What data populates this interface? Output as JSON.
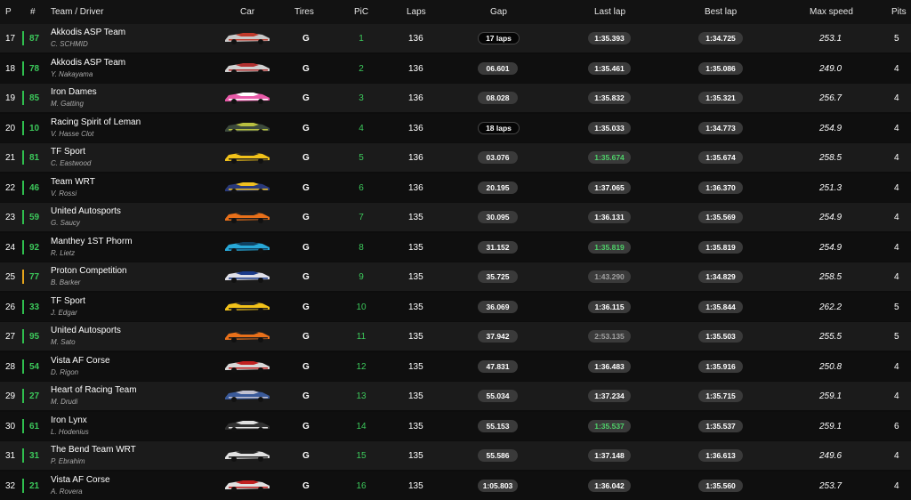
{
  "headers": {
    "p": "P",
    "num": "#",
    "team": "Team / Driver",
    "car": "Car",
    "tires": "Tires",
    "pic": "PiC",
    "laps": "Laps",
    "gap": "Gap",
    "last": "Last lap",
    "best": "Best lap",
    "speed": "Max speed",
    "pits": "Pits"
  },
  "rows": [
    {
      "p": "17",
      "num": "87",
      "team": "Akkodis ASP Team",
      "driver": "C. SCHMID",
      "tire": "G",
      "pic": "1",
      "laps": "136",
      "gap": "17 laps",
      "last": "1:35.393",
      "best": "1:34.725",
      "speed": "253.1",
      "pits": "5",
      "bar": "pro",
      "gap_style": "dark",
      "last_style": "normal",
      "car_colors": [
        "#c8c8c8",
        "#c0392b"
      ]
    },
    {
      "p": "18",
      "num": "78",
      "team": "Akkodis ASP Team",
      "driver": "Y. Nakayama",
      "tire": "G",
      "pic": "2",
      "laps": "136",
      "gap": "06.601",
      "last": "1:35.461",
      "best": "1:35.086",
      "speed": "249.0",
      "pits": "4",
      "bar": "pro",
      "gap_style": "normal",
      "last_style": "normal",
      "car_colors": [
        "#d0d0d0",
        "#b03030"
      ]
    },
    {
      "p": "19",
      "num": "85",
      "team": "Iron Dames",
      "driver": "M. Gatting",
      "tire": "G",
      "pic": "3",
      "laps": "136",
      "gap": "08.028",
      "last": "1:35.832",
      "best": "1:35.321",
      "speed": "256.7",
      "pits": "4",
      "bar": "pro",
      "gap_style": "normal",
      "last_style": "normal",
      "car_colors": [
        "#e85aa8",
        "#ffffff"
      ]
    },
    {
      "p": "20",
      "num": "10",
      "team": "Racing Spirit of Leman",
      "driver": "V. Hasse Clot",
      "tire": "G",
      "pic": "4",
      "laps": "136",
      "gap": "18 laps",
      "last": "1:35.033",
      "best": "1:34.773",
      "speed": "254.9",
      "pits": "4",
      "bar": "pro",
      "gap_style": "dark",
      "last_style": "normal",
      "car_colors": [
        "#3c4a3c",
        "#b8c040"
      ]
    },
    {
      "p": "21",
      "num": "81",
      "team": "TF Sport",
      "driver": "C. Eastwood",
      "tire": "G",
      "pic": "5",
      "laps": "136",
      "gap": "03.076",
      "last": "1:35.674",
      "best": "1:35.674",
      "speed": "258.5",
      "pits": "4",
      "bar": "pro",
      "gap_style": "normal",
      "last_style": "green",
      "car_colors": [
        "#f2c21a",
        "#222222"
      ]
    },
    {
      "p": "22",
      "num": "46",
      "team": "Team WRT",
      "driver": "V. Rossi",
      "tire": "G",
      "pic": "6",
      "laps": "136",
      "gap": "20.195",
      "last": "1:37.065",
      "best": "1:36.370",
      "speed": "251.3",
      "pits": "4",
      "bar": "pro",
      "gap_style": "normal",
      "last_style": "normal",
      "car_colors": [
        "#2a3a7a",
        "#f0c020"
      ]
    },
    {
      "p": "23",
      "num": "59",
      "team": "United Autosports",
      "driver": "G. Saucy",
      "tire": "G",
      "pic": "7",
      "laps": "135",
      "gap": "30.095",
      "last": "1:36.131",
      "best": "1:35.569",
      "speed": "254.9",
      "pits": "4",
      "bar": "pro",
      "gap_style": "normal",
      "last_style": "normal",
      "car_colors": [
        "#e8701a",
        "#202020"
      ]
    },
    {
      "p": "24",
      "num": "92",
      "team": "Manthey 1ST Phorm",
      "driver": "R. Lietz",
      "tire": "G",
      "pic": "8",
      "laps": "135",
      "gap": "31.152",
      "last": "1:35.819",
      "best": "1:35.819",
      "speed": "254.9",
      "pits": "4",
      "bar": "pro",
      "gap_style": "normal",
      "last_style": "green",
      "car_colors": [
        "#28a8d8",
        "#104060"
      ]
    },
    {
      "p": "25",
      "num": "77",
      "team": "Proton Competition",
      "driver": "B. Barker",
      "tire": "G",
      "pic": "9",
      "laps": "135",
      "gap": "35.725",
      "last": "1:43.290",
      "best": "1:34.829",
      "speed": "258.5",
      "pits": "4",
      "bar": "am",
      "gap_style": "normal",
      "last_style": "grey",
      "car_colors": [
        "#e0e0e8",
        "#1a3a8a"
      ]
    },
    {
      "p": "26",
      "num": "33",
      "team": "TF Sport",
      "driver": "J. Edgar",
      "tire": "G",
      "pic": "10",
      "laps": "135",
      "gap": "36.069",
      "last": "1:36.115",
      "best": "1:35.844",
      "speed": "262.2",
      "pits": "5",
      "bar": "pro",
      "gap_style": "normal",
      "last_style": "normal",
      "car_colors": [
        "#f2c21a",
        "#222222"
      ]
    },
    {
      "p": "27",
      "num": "95",
      "team": "United Autosports",
      "driver": "M. Sato",
      "tire": "G",
      "pic": "11",
      "laps": "135",
      "gap": "37.942",
      "last": "2:53.135",
      "best": "1:35.503",
      "speed": "255.5",
      "pits": "5",
      "bar": "pro",
      "gap_style": "normal",
      "last_style": "grey",
      "car_colors": [
        "#e8701a",
        "#202020"
      ]
    },
    {
      "p": "28",
      "num": "54",
      "team": "Vista AF Corse",
      "driver": "D. Rigon",
      "tire": "G",
      "pic": "12",
      "laps": "135",
      "gap": "47.831",
      "last": "1:36.483",
      "best": "1:35.916",
      "speed": "250.8",
      "pits": "4",
      "bar": "pro",
      "gap_style": "normal",
      "last_style": "normal",
      "car_colors": [
        "#d8d8d8",
        "#c02020"
      ]
    },
    {
      "p": "29",
      "num": "27",
      "team": "Heart of Racing Team",
      "driver": "M. Drudi",
      "tire": "G",
      "pic": "13",
      "laps": "135",
      "gap": "55.034",
      "last": "1:37.234",
      "best": "1:35.715",
      "speed": "259.1",
      "pits": "4",
      "bar": "pro",
      "gap_style": "normal",
      "last_style": "normal",
      "car_colors": [
        "#3a5a9a",
        "#c0c0d0"
      ]
    },
    {
      "p": "30",
      "num": "61",
      "team": "Iron Lynx",
      "driver": "L. Hodenius",
      "tire": "G",
      "pic": "14",
      "laps": "135",
      "gap": "55.153",
      "last": "1:35.537",
      "best": "1:35.537",
      "speed": "259.1",
      "pits": "6",
      "bar": "pro",
      "gap_style": "normal",
      "last_style": "green",
      "car_colors": [
        "#303030",
        "#e0e0e0"
      ]
    },
    {
      "p": "31",
      "num": "31",
      "team": "The Bend Team WRT",
      "driver": "P. Ebrahim",
      "tire": "G",
      "pic": "15",
      "laps": "135",
      "gap": "55.586",
      "last": "1:37.148",
      "best": "1:36.613",
      "speed": "249.6",
      "pits": "4",
      "bar": "pro",
      "gap_style": "normal",
      "last_style": "normal",
      "car_colors": [
        "#e0e0e0",
        "#202020"
      ]
    },
    {
      "p": "32",
      "num": "21",
      "team": "Vista AF Corse",
      "driver": "A. Rovera",
      "tire": "G",
      "pic": "16",
      "laps": "135",
      "gap": "1:05.803",
      "last": "1:36.042",
      "best": "1:35.560",
      "speed": "253.7",
      "pits": "4",
      "bar": "pro",
      "gap_style": "normal",
      "last_style": "normal",
      "car_colors": [
        "#e0e0e0",
        "#c02020"
      ]
    }
  ]
}
